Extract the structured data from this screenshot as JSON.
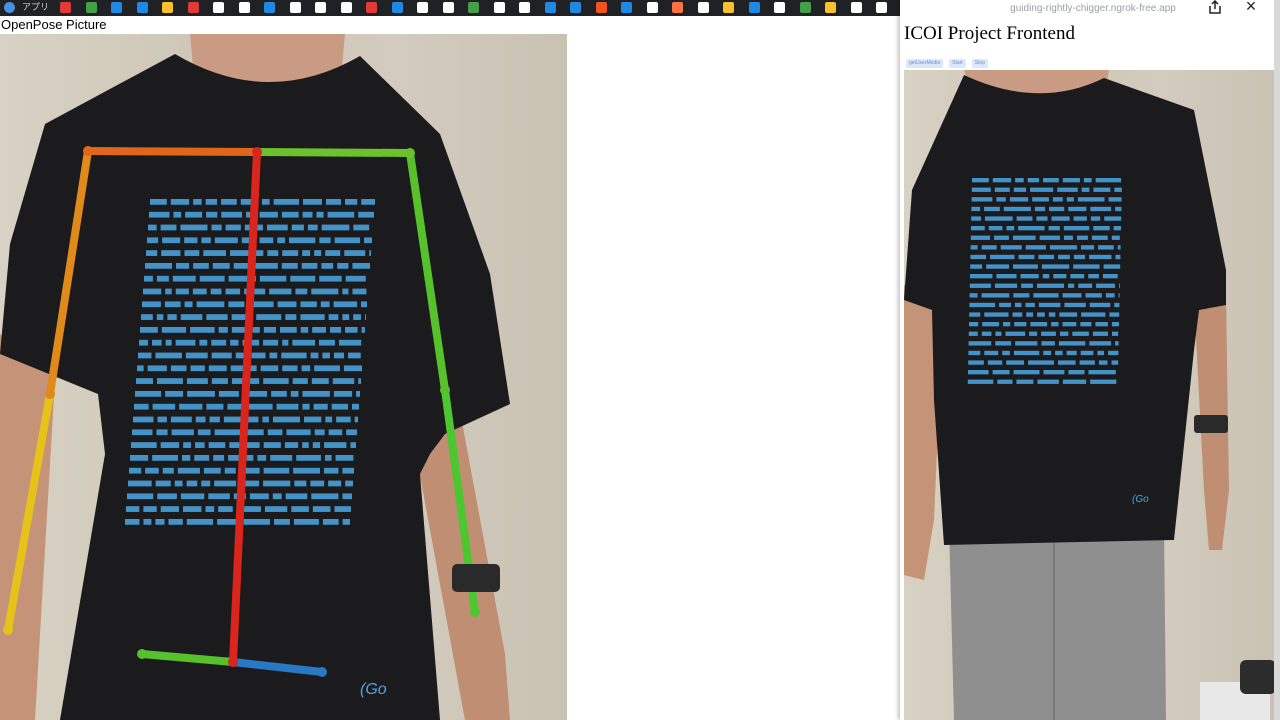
{
  "bookmarks_bar": {
    "first_label": "アプリ",
    "icon_colors": [
      "#4a90e2",
      "#e53935",
      "#43a047",
      "#1e88e5",
      "#1e88e5",
      "#fbc02d",
      "#e53935",
      "#ffffff",
      "#ffffff",
      "#1e88e5",
      "#ffffff",
      "#ffffff",
      "#ffffff",
      "#e53935",
      "#1e88e5",
      "#ffffff",
      "#ffffff",
      "#43a047",
      "#ffffff",
      "#ffffff",
      "#1e88e5",
      "#1e88e5",
      "#f4511e",
      "#1e88e5",
      "#ffffff",
      "#ff7043",
      "#ffffff",
      "#fbc02d",
      "#1e88e5",
      "#ffffff",
      "#43a047",
      "#fbc02d",
      "#ffffff",
      "#ffffff",
      "#26a69a",
      "#1e88e5"
    ]
  },
  "left_pane": {
    "heading": "OpenPose Picture"
  },
  "popup": {
    "url": "guiding-rightly-chigger.ngrok-free.app",
    "title": "ICOI Project Frontend",
    "share_icon": "share-icon",
    "close_icon": "×",
    "tabs": [
      "getUserMedia",
      "Start",
      "Stop"
    ]
  },
  "colors": {
    "shirt": "#1b1b1d",
    "code_text": "#4aa8e8",
    "pose_red": "#d9251c",
    "pose_orange": "#e0661b",
    "pose_green": "#57c12b",
    "pose_yellow": "#e7c21a",
    "pose_blue": "#2779c4"
  }
}
